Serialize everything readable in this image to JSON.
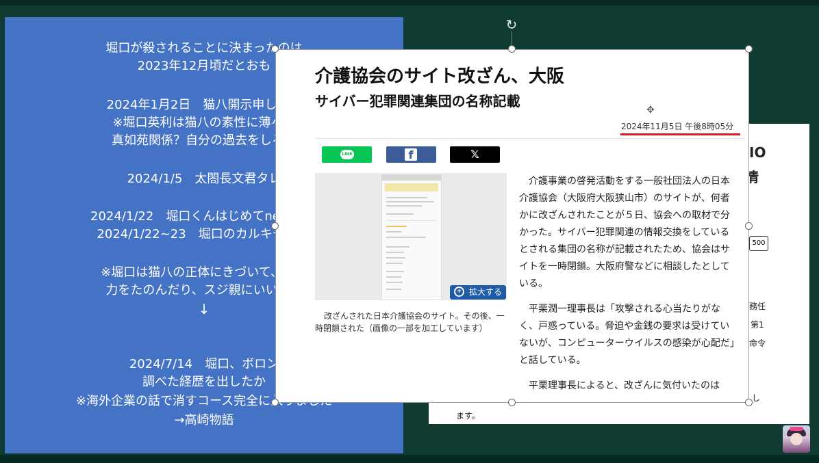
{
  "slide": {
    "lines": [
      "堀口が殺されることに決まったのは",
      "2023年12月頃だとおも",
      "2024年1月2日　猫八開示申し立て",
      "※堀口英利は猫八の素性に薄々感",
      "真如苑関係？自分の過去をしる？",
      "2024/1/5　太閤長文君タレ",
      "2024/1/22　堀口くんはじめてneko800",
      "2024/1/22~23　堀口のカルキチblog",
      "※堀口は猫八の正体にきづいて、仲間",
      "力をたのんだり、スジ親にいいつけ",
      "↓",
      "2024/7/14　堀口、ボロン",
      "調べた経歴を出したか",
      "※海外企業の話で消すコース完全に入りました",
      "→高崎物語"
    ]
  },
  "backpage": {
    "frag_top": "IO",
    "frag_heading": "情",
    "frag_box": "500",
    "frag_r1": "務任",
    "frag_r2": "第1",
    "frag_r3": "命令",
    "frag_r4": "し",
    "frag_bottom": "ます。"
  },
  "article": {
    "title": "介護協会のサイト改ざん、大阪",
    "subtitle": "サイバー犯罪関連集団の名称記載",
    "date": "2024年11月5日 午後8時05分",
    "share": {
      "line": "LINE",
      "facebook": "f",
      "x": "𝕏"
    },
    "zoom_label": "拡大する",
    "caption": "改ざんされた日本介護協会のサイト。その後、一時閉鎖された（画像の一部を加工しています）",
    "paragraphs": [
      "介護事業の啓発活動をする一般社団法人の日本介護協会（大阪府大阪狭山市）のサイトが、何者かに改ざんされたことが５日、協会への取材で分かった。サイバー犯罪関連の情報交換をしているとされる集団の名称が記載されたため、協会はサイトを一時閉鎖。大阪府警などに相談したとしている。",
      "平栗潤一理事長は「攻撃される心当たりがなく、戸惑っている。脅迫や金銭の要求は受けていないが、コンピューターウイルスの感染が心配だ」と話している。",
      "平栗理事長によると、改ざんに気付いたのは"
    ]
  },
  "colors": {
    "background": "#0f3b33",
    "slide": "#4472c4",
    "date_underline": "#e0181e",
    "line": "#06c755",
    "facebook": "#3b5b99"
  },
  "icons": [
    "rotate-icon",
    "move-cursor-icon",
    "zoom-icon",
    "line-icon",
    "facebook-icon",
    "x-icon",
    "avatar"
  ]
}
